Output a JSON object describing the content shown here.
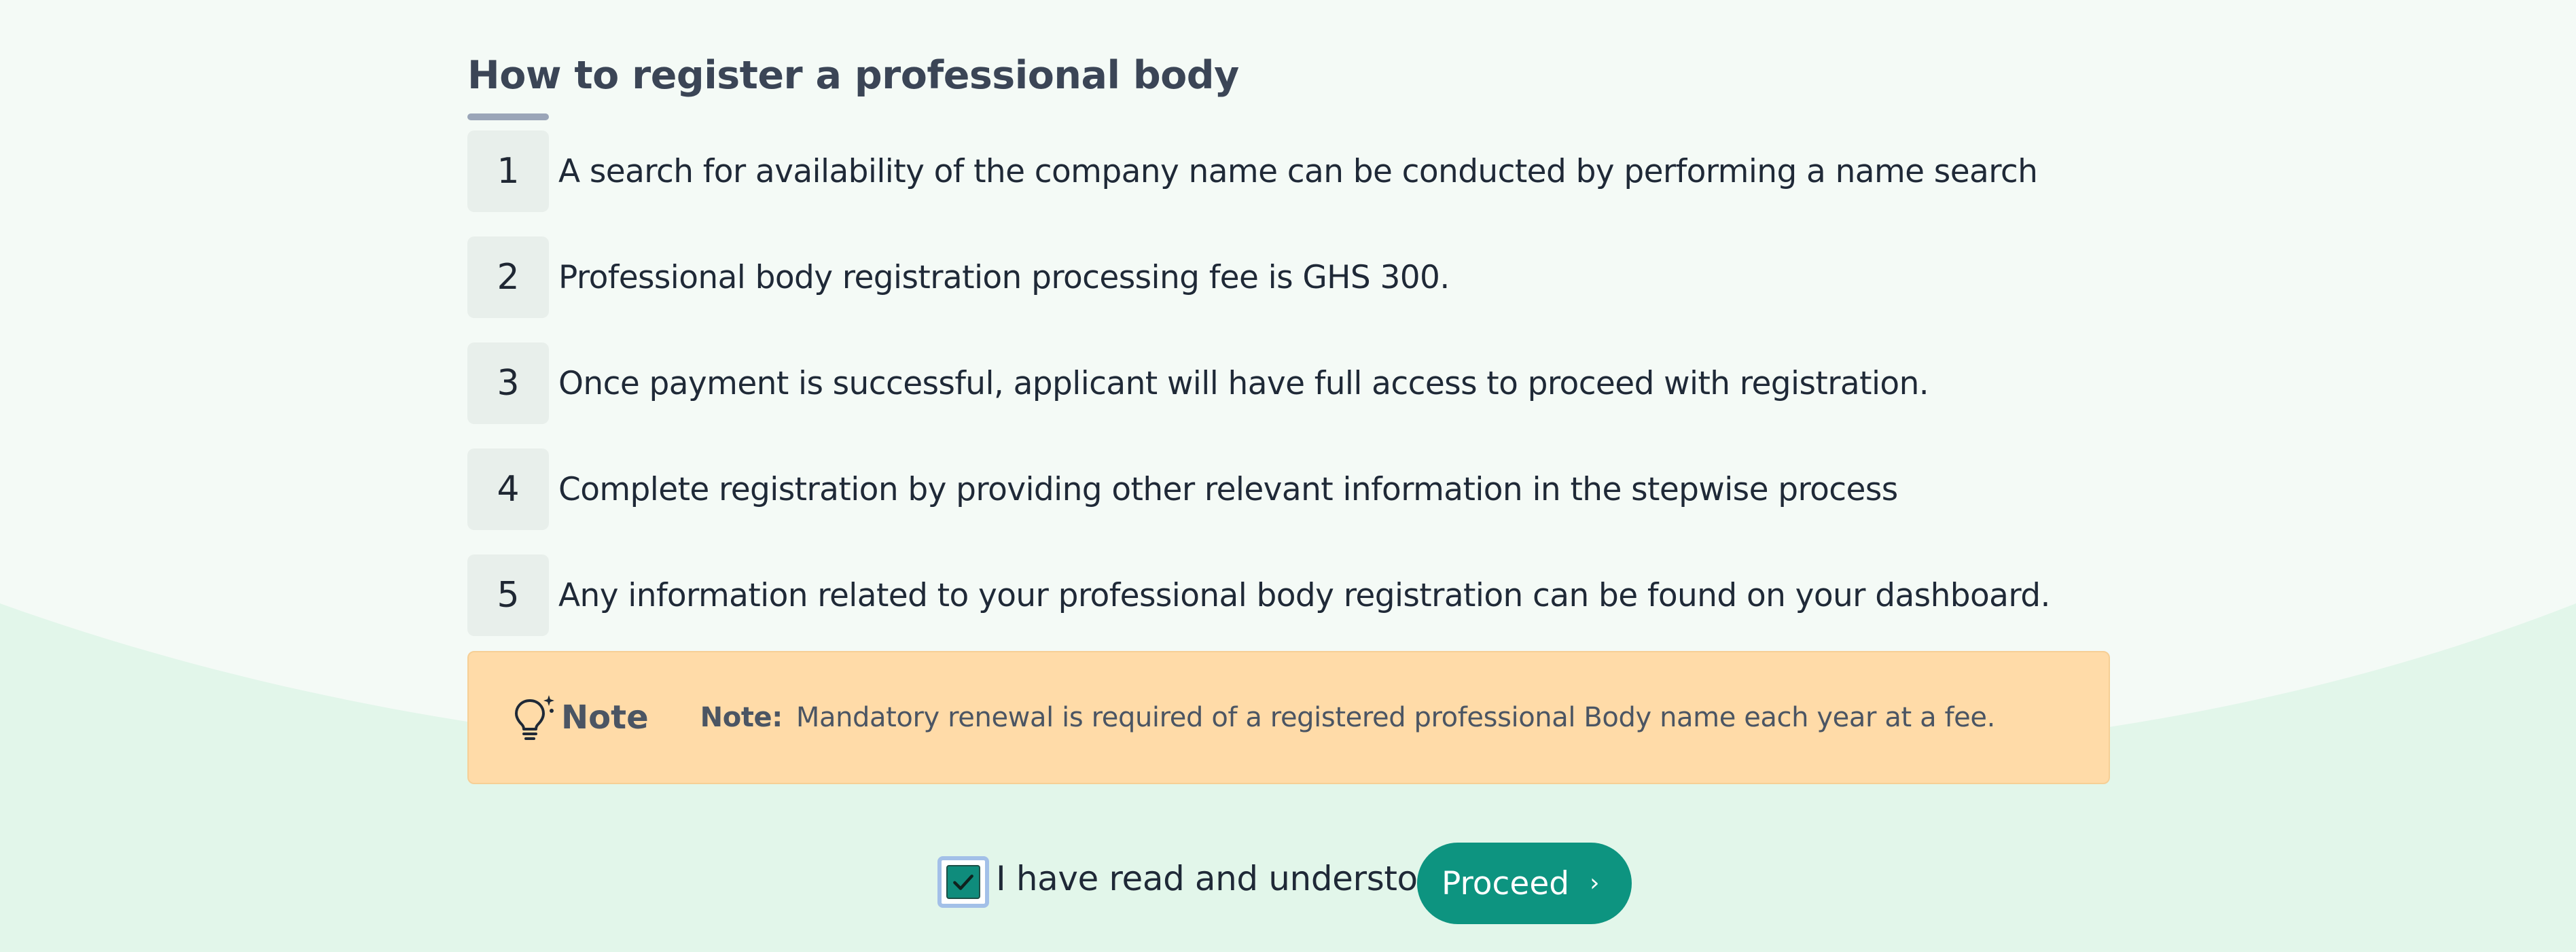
{
  "page": {
    "title": "How to register a professional body"
  },
  "steps": [
    {
      "number": "1",
      "text": "A search for availability of the company name can be conducted by performing a name search"
    },
    {
      "number": "2",
      "text": "Professional body registration processing fee is GHS 300."
    },
    {
      "number": "3",
      "text": "Once payment is successful, applicant will have full access to proceed with registration."
    },
    {
      "number": "4",
      "text": "Complete registration by providing other relevant information in the stepwise process"
    },
    {
      "number": "5",
      "text": "Any information related to your professional body registration can be found on your dashboard."
    }
  ],
  "note": {
    "badge_label": "Note",
    "icon": "lightbulb-sparkle-icon",
    "body_label": "Note:",
    "body_text": "Mandatory renewal is required of a registered professional Body name each year at a fee."
  },
  "agreement": {
    "checked": true,
    "label": "I have read and understood"
  },
  "proceed": {
    "label": "Proceed",
    "icon": "chevron-right-icon"
  },
  "colors": {
    "background": "#f4faf6",
    "wave": "#e2f6ea",
    "note_background": "#ffdba8",
    "accent": "#0d9480",
    "title": "#3b4556"
  }
}
